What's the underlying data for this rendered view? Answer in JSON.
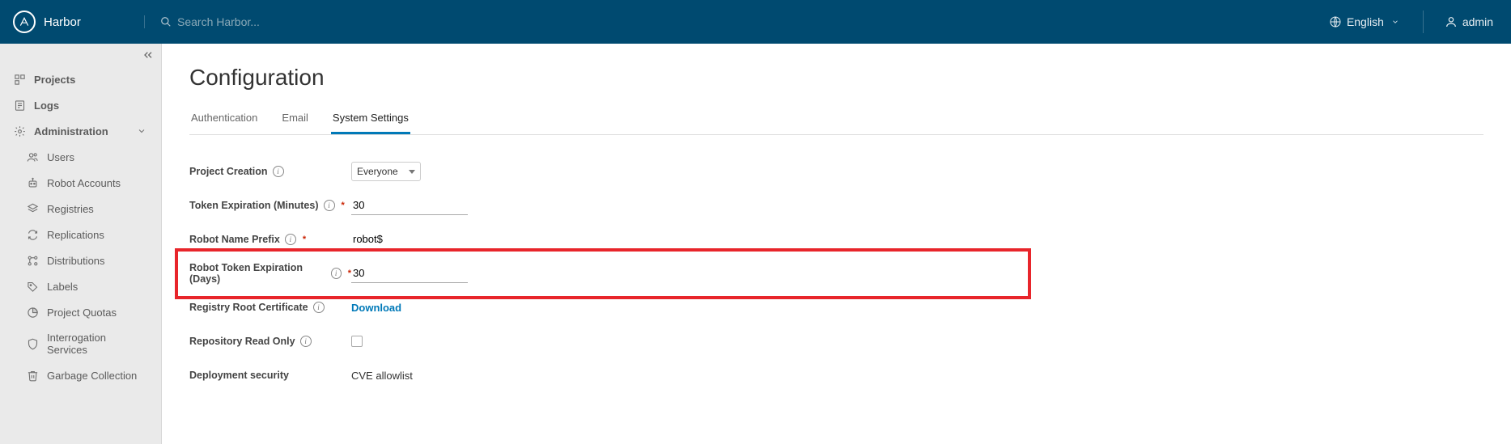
{
  "header": {
    "brand": "Harbor",
    "search_placeholder": "Search Harbor...",
    "language": "English",
    "user": "admin"
  },
  "sidebar": {
    "projects": "Projects",
    "logs": "Logs",
    "administration": "Administration",
    "items": [
      {
        "label": "Users"
      },
      {
        "label": "Robot Accounts"
      },
      {
        "label": "Registries"
      },
      {
        "label": "Replications"
      },
      {
        "label": "Distributions"
      },
      {
        "label": "Labels"
      },
      {
        "label": "Project Quotas"
      },
      {
        "label": "Interrogation Services"
      },
      {
        "label": "Garbage Collection"
      }
    ]
  },
  "main": {
    "title": "Configuration",
    "tabs": [
      {
        "label": "Authentication"
      },
      {
        "label": "Email"
      },
      {
        "label": "System Settings"
      }
    ],
    "form": {
      "project_creation": {
        "label": "Project Creation",
        "value": "Everyone"
      },
      "token_expiration": {
        "label": "Token Expiration (Minutes)",
        "value": "30"
      },
      "robot_name_prefix": {
        "label": "Robot Name Prefix",
        "value": "robot$"
      },
      "robot_token_expiration": {
        "label": "Robot Token Expiration (Days)",
        "value": "30"
      },
      "registry_root_cert": {
        "label": "Registry Root Certificate",
        "action": "Download"
      },
      "repo_read_only": {
        "label": "Repository Read Only"
      },
      "deployment_security": {
        "label": "Deployment security",
        "value": "CVE allowlist"
      }
    }
  }
}
